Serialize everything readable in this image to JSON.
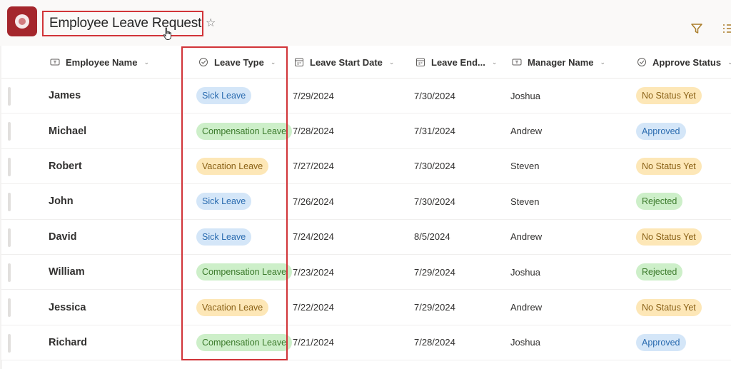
{
  "header": {
    "title": "Employee Leave Request",
    "app_icon": "app-logo-icon",
    "favorite_icon": "star-icon",
    "tools": [
      {
        "name": "filter",
        "icon": "filter-icon"
      },
      {
        "name": "views",
        "icon": "list-view-icon"
      }
    ]
  },
  "columns": [
    {
      "key": "employee",
      "label": "Employee Name",
      "icon": "text-field-icon"
    },
    {
      "key": "leave_type",
      "label": "Leave Type",
      "icon": "choice-field-icon"
    },
    {
      "key": "start",
      "label": "Leave Start Date",
      "icon": "calendar-icon"
    },
    {
      "key": "end",
      "label": "Leave End...",
      "icon": "calendar-icon"
    },
    {
      "key": "manager",
      "label": "Manager Name",
      "icon": "text-field-icon"
    },
    {
      "key": "status",
      "label": "Approve Status",
      "icon": "choice-field-icon"
    }
  ],
  "pill_colors": {
    "Sick Leave": {
      "bg": "#d4e6f8",
      "fg": "#2b6cb0"
    },
    "Compensation Leave": {
      "bg": "#cdefc9",
      "fg": "#3b7a2b"
    },
    "Vacation Leave": {
      "bg": "#fde7b7",
      "fg": "#8a6116"
    },
    "No Status Yet": {
      "bg": "#fde7b7",
      "fg": "#8a6116"
    },
    "Approved": {
      "bg": "#d4e6f8",
      "fg": "#2b6cb0"
    },
    "Rejected": {
      "bg": "#cdefc9",
      "fg": "#3b7a2b"
    }
  },
  "rows": [
    {
      "employee": "James",
      "leave_type": "Sick Leave",
      "start": "7/29/2024",
      "end": "7/30/2024",
      "manager": "Joshua",
      "status": "No Status Yet"
    },
    {
      "employee": "Michael",
      "leave_type": "Compensation Leave",
      "start": "7/28/2024",
      "end": "7/31/2024",
      "manager": "Andrew",
      "status": "Approved"
    },
    {
      "employee": "Robert",
      "leave_type": "Vacation Leave",
      "start": "7/27/2024",
      "end": "7/30/2024",
      "manager": "Steven",
      "status": "No Status Yet"
    },
    {
      "employee": "John",
      "leave_type": "Sick Leave",
      "start": "7/26/2024",
      "end": "7/30/2024",
      "manager": "Steven",
      "status": "Rejected"
    },
    {
      "employee": "David",
      "leave_type": "Sick Leave",
      "start": "7/24/2024",
      "end": "8/5/2024",
      "manager": "Andrew",
      "status": "No Status Yet"
    },
    {
      "employee": "William",
      "leave_type": "Compensation Leave",
      "start": "7/23/2024",
      "end": "7/29/2024",
      "manager": "Joshua",
      "status": "Rejected"
    },
    {
      "employee": "Jessica",
      "leave_type": "Vacation Leave",
      "start": "7/22/2024",
      "end": "7/29/2024",
      "manager": "Andrew",
      "status": "No Status Yet"
    },
    {
      "employee": "Richard",
      "leave_type": "Compensation Leave",
      "start": "7/21/2024",
      "end": "7/28/2024",
      "manager": "Joshua",
      "status": "Approved"
    }
  ],
  "highlights": {
    "title_box_color": "#d13438",
    "column_box_color": "#d13438"
  }
}
